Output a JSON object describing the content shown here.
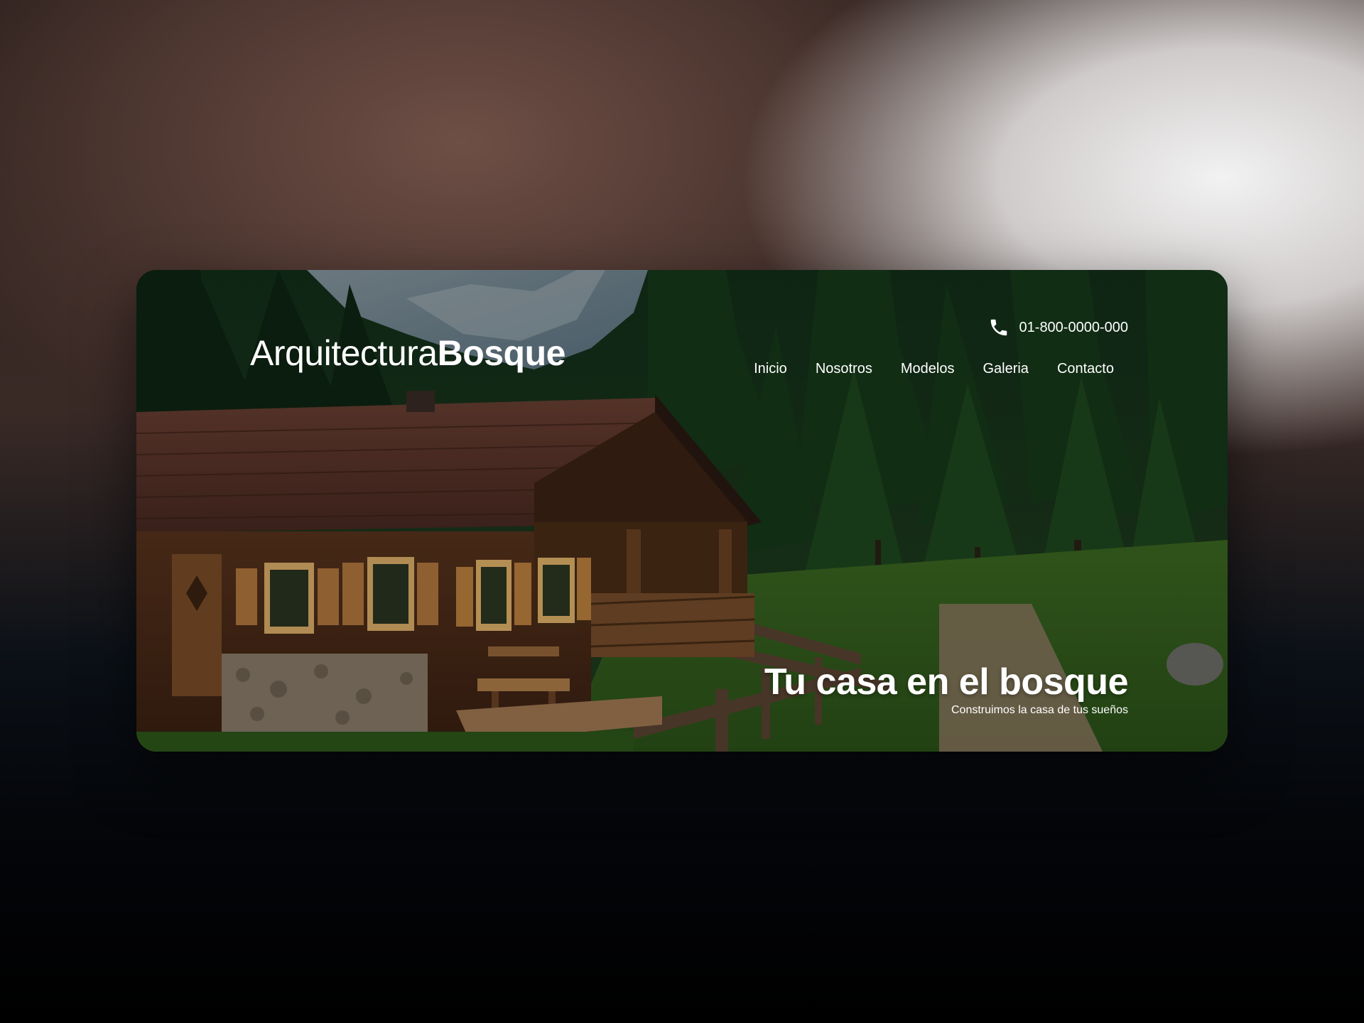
{
  "brand": {
    "logo_light": "Arquitectura",
    "logo_bold": "Bosque"
  },
  "contact": {
    "phone": "01-800-0000-000",
    "icon": "phone-icon"
  },
  "nav": {
    "items": [
      {
        "label": "Inicio"
      },
      {
        "label": "Nosotros"
      },
      {
        "label": "Modelos"
      },
      {
        "label": "Galeria"
      },
      {
        "label": "Contacto"
      }
    ]
  },
  "hero": {
    "title": "Tu casa en el bosque",
    "subtitle": "Construimos la casa de tus sueños"
  },
  "colors": {
    "text": "#ffffff",
    "forest": "#1d3a1c",
    "roof": "#7a4a38",
    "wood": "#6b3f22"
  }
}
